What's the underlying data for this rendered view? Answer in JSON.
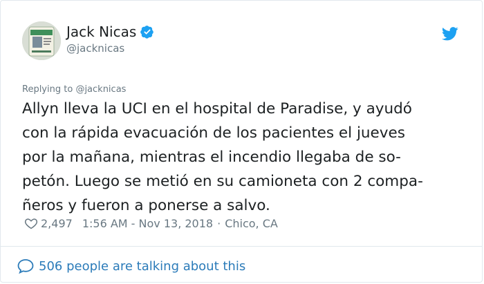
{
  "author": {
    "display_name": "Jack Nicas",
    "handle": "@jacknicas",
    "verified_icon": "verified-badge-icon",
    "avatar_icon": "avatar-image"
  },
  "reply": {
    "prefix": "Replying to",
    "handle": "@jacknicas"
  },
  "tweet": {
    "text": "Allyn lleva la UCI en el hospital de Paradise, y ayudó\ncon la rápida evacuación de los pacientes el jueves\npor la mañana, mientras el incendio llegaba de so-\npetón. Luego se metió en su camioneta con 2 compa-\nñeros y fueron a ponerse a salvo."
  },
  "meta": {
    "likes": "2,497",
    "timestamp": "1:56 AM - Nov 13, 2018",
    "separator": "·",
    "location": "Chico, CA"
  },
  "footer": {
    "talking": "506 people are talking about this"
  },
  "colors": {
    "twitter_blue": "#1da1f2",
    "link_blue": "#2b7bb9",
    "muted_gray": "#697882",
    "text_dark": "#1c2022",
    "border": "#e1e8ed"
  }
}
